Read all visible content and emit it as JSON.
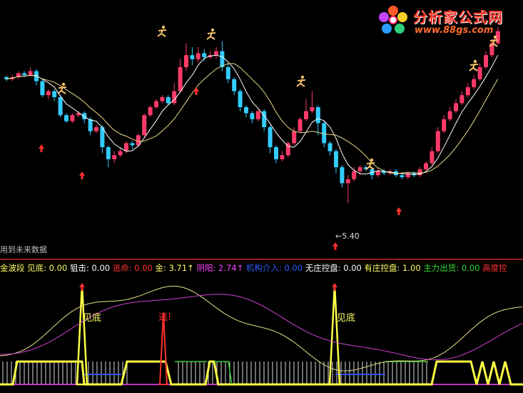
{
  "logo": {
    "title": "分析家公式网",
    "url": "www.88gs.com"
  },
  "main": {
    "note": "用到未来数据",
    "price_label": "←5.40"
  },
  "legend": {
    "items": [
      {
        "label": "金波段 见底: 0.00",
        "color": "#ffff66"
      },
      {
        "label": "狙击: 0.00",
        "color": "#ffffff"
      },
      {
        "label": "逃命: 0.00",
        "color": "#ff3030"
      },
      {
        "label": "金: 3.71↑",
        "color": "#ffff66"
      },
      {
        "label": "阴阳: 2.74↑",
        "color": "#ff44ff"
      },
      {
        "label": "机构介入: 0.00",
        "color": "#3060ff"
      },
      {
        "label": "无庄控盘: 0.00",
        "color": "#ffffff"
      },
      {
        "label": "有庄控盘: 1.00",
        "color": "#ffff66"
      },
      {
        "label": "主力出货: 0.00",
        "color": "#33dd33"
      },
      {
        "label": "高度控",
        "color": "#ff3030"
      }
    ]
  },
  "sub": {
    "markers": [
      {
        "text": "见底",
        "color": "#ffff66"
      },
      {
        "text": "逃!",
        "color": "#ff3030"
      },
      {
        "text": "见底",
        "color": "#ffff66"
      }
    ]
  },
  "colors": {
    "up": "#ff3a6a",
    "down": "#33ccff",
    "ma1": "#ffffff",
    "ma2": "#e8d88a",
    "arrow": "#ff3030",
    "figure": "#f5c16a",
    "divider": "#9b1b1b"
  },
  "chart_data": {
    "type": "candlestick",
    "candles": [
      [
        15,
        14,
        16,
        13
      ],
      [
        14,
        15,
        16,
        13
      ],
      [
        15,
        17,
        18,
        14
      ],
      [
        17,
        16,
        18,
        15
      ],
      [
        16,
        18,
        20,
        15
      ],
      [
        18,
        13,
        19,
        11
      ],
      [
        13,
        6,
        14,
        5
      ],
      [
        6,
        8,
        9,
        4
      ],
      [
        8,
        5,
        9,
        3
      ],
      [
        5,
        -4,
        6,
        -5
      ],
      [
        -4,
        -7,
        -3,
        -8
      ],
      [
        -7,
        -4,
        -3,
        -8
      ],
      [
        -4,
        -3,
        -2,
        -5
      ],
      [
        -3,
        -6,
        -2,
        -8
      ],
      [
        -6,
        -12,
        -5,
        -14
      ],
      [
        -12,
        -10,
        -9,
        -13
      ],
      [
        -10,
        -20,
        -9,
        -23
      ],
      [
        -20,
        -26,
        -19,
        -30
      ],
      [
        -26,
        -24,
        -22,
        -28
      ],
      [
        -24,
        -22,
        -20,
        -25
      ],
      [
        -22,
        -18,
        -17,
        -23
      ],
      [
        -18,
        -19,
        -17,
        -21
      ],
      [
        -19,
        -14,
        -13,
        -20
      ],
      [
        -14,
        -4,
        -3,
        -15
      ],
      [
        -4,
        0,
        1,
        -5
      ],
      [
        0,
        3,
        4,
        -1
      ],
      [
        3,
        5,
        6,
        2
      ],
      [
        5,
        2,
        6,
        1
      ],
      [
        2,
        8,
        12,
        1
      ],
      [
        8,
        20,
        24,
        7
      ],
      [
        20,
        26,
        32,
        18
      ],
      [
        26,
        24,
        30,
        21
      ],
      [
        24,
        27,
        30,
        22
      ],
      [
        27,
        25,
        29,
        23
      ],
      [
        25,
        26,
        28,
        24
      ],
      [
        26,
        28,
        30,
        24
      ],
      [
        28,
        20,
        33,
        18
      ],
      [
        20,
        14,
        22,
        12
      ],
      [
        14,
        8,
        15,
        6
      ],
      [
        8,
        0,
        9,
        -2
      ],
      [
        0,
        -3,
        1,
        -5
      ],
      [
        -3,
        -6,
        -2,
        -8
      ],
      [
        -6,
        -2,
        -1,
        -7
      ],
      [
        -2,
        -10,
        -1,
        -12
      ],
      [
        -10,
        -20,
        -9,
        -23
      ],
      [
        -20,
        -26,
        -19,
        -28
      ],
      [
        -26,
        -24,
        -22,
        -27
      ],
      [
        -24,
        -18,
        -17,
        -25
      ],
      [
        -18,
        -12,
        -10,
        -19
      ],
      [
        -12,
        -6,
        -5,
        -13
      ],
      [
        -6,
        -2,
        4,
        -7
      ],
      [
        -2,
        0,
        8,
        -3
      ],
      [
        0,
        -8,
        1,
        -14
      ],
      [
        -8,
        -18,
        -7,
        -20
      ],
      [
        -18,
        -22,
        -17,
        -24
      ],
      [
        -22,
        -30,
        -21,
        -33
      ],
      [
        -30,
        -38,
        -29,
        -40
      ],
      [
        -38,
        -36,
        -34,
        -48
      ],
      [
        -36,
        -32,
        -30,
        -37
      ],
      [
        -32,
        -30,
        -29,
        -34
      ],
      [
        -30,
        -31,
        -29,
        -32
      ],
      [
        -31,
        -34,
        -30,
        -36
      ],
      [
        -34,
        -32,
        -30,
        -35
      ],
      [
        -32,
        -33,
        -31,
        -34
      ],
      [
        -33,
        -32,
        -31,
        -34
      ],
      [
        -32,
        -34,
        -31,
        -35
      ],
      [
        -34,
        -35,
        -33,
        -36
      ],
      [
        -35,
        -33,
        -32,
        -36
      ],
      [
        -33,
        -34,
        -32,
        -35
      ],
      [
        -34,
        -31,
        -30,
        -35
      ],
      [
        -31,
        -28,
        -27,
        -32
      ],
      [
        -28,
        -22,
        -20,
        -29
      ],
      [
        -22,
        -12,
        -10,
        -23
      ],
      [
        -12,
        -6,
        -4,
        -13
      ],
      [
        -6,
        -2,
        0,
        -7
      ],
      [
        -2,
        2,
        4,
        -3
      ],
      [
        2,
        6,
        8,
        1
      ],
      [
        6,
        10,
        12,
        5
      ],
      [
        10,
        14,
        16,
        9
      ],
      [
        14,
        20,
        22,
        13
      ],
      [
        20,
        26,
        28,
        19
      ],
      [
        26,
        32,
        34,
        25
      ],
      [
        32,
        38,
        40,
        31
      ]
    ]
  }
}
